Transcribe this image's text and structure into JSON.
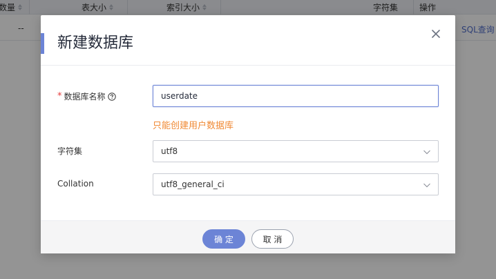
{
  "background_table": {
    "headers": {
      "col_count_partial": "数量",
      "table_size": "表大小",
      "index_size": "索引大小",
      "charset": "字符集",
      "actions": "操作"
    },
    "row": {
      "placeholder": "--",
      "action_link": "SQL查询"
    }
  },
  "dialog": {
    "title": "新建数据库",
    "close_icon": "close-icon",
    "fields": {
      "db_name": {
        "required_mark": "*",
        "label": "数据库名称",
        "help_icon": "question-circle-icon",
        "value": "userdate",
        "hint": "只能创建用户数据库"
      },
      "charset": {
        "label": "字符集",
        "value": "utf8",
        "arrow_icon": "chevron-down-icon"
      },
      "collation": {
        "label": "Collation",
        "value": "utf8_general_ci",
        "arrow_icon": "chevron-down-icon"
      }
    },
    "footer": {
      "confirm_label": "确 定",
      "cancel_label": "取 消"
    }
  },
  "colors": {
    "accent": "#6c84d6",
    "hint": "#f08a35",
    "required": "#e53b3b",
    "mask": "rgba(0,0,0,0.42)"
  }
}
